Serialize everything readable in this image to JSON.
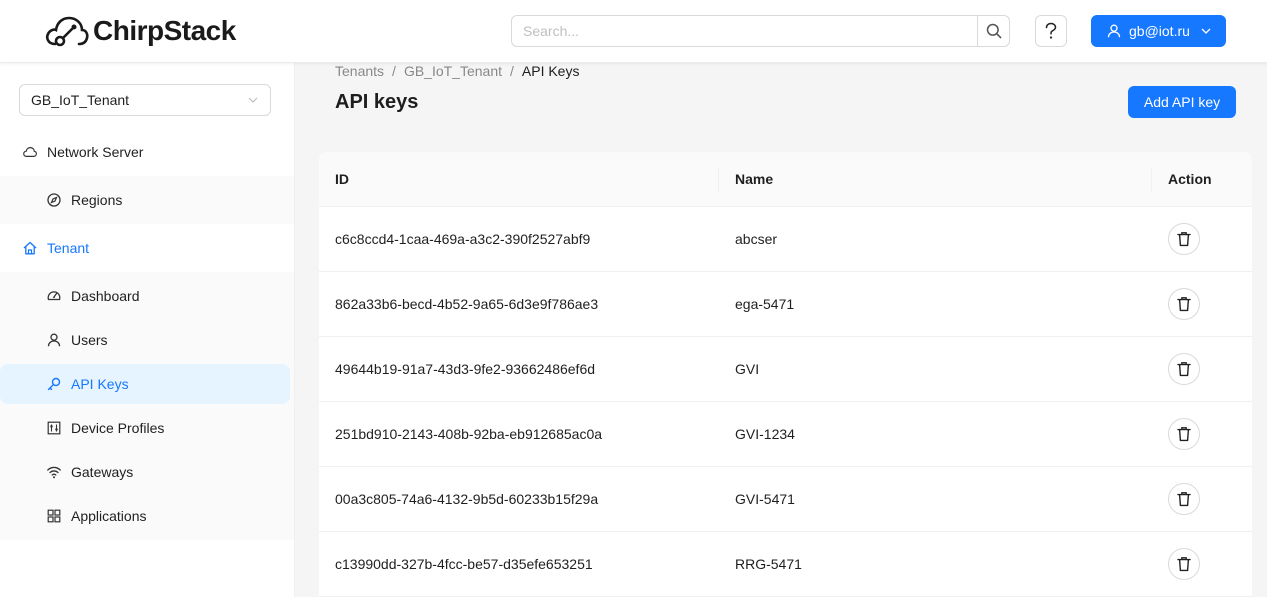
{
  "header": {
    "logo_text": "ChirpStack",
    "search_placeholder": "Search...",
    "user_email": "gb@iot.ru"
  },
  "sidebar": {
    "tenant_select": "GB_IoT_Tenant",
    "network_server": {
      "label": "Network Server",
      "icon": "cloud-icon"
    },
    "regions": {
      "label": "Regions",
      "icon": "compass-icon"
    },
    "tenant": {
      "label": "Tenant",
      "icon": "home-icon"
    },
    "items": [
      {
        "label": "Dashboard",
        "icon": "dashboard-icon"
      },
      {
        "label": "Users",
        "icon": "user-icon"
      },
      {
        "label": "API Keys",
        "icon": "key-icon",
        "selected": true
      },
      {
        "label": "Device Profiles",
        "icon": "control-icon"
      },
      {
        "label": "Gateways",
        "icon": "wifi-icon"
      },
      {
        "label": "Applications",
        "icon": "appstore-icon"
      }
    ]
  },
  "breadcrumb": [
    "Tenants",
    "GB_IoT_Tenant",
    "API Keys"
  ],
  "page": {
    "title": "API keys",
    "add_button": "Add API key"
  },
  "table": {
    "columns": [
      "ID",
      "Name",
      "Action"
    ],
    "rows": [
      {
        "id": "c6c8ccd4-1caa-469a-a3c2-390f2527abf9",
        "name": "abcser"
      },
      {
        "id": "862a33b6-becd-4b52-9a65-6d3e9f786ae3",
        "name": "ega-5471"
      },
      {
        "id": "49644b19-91a7-43d3-9fe2-93662486ef6d",
        "name": "GVI"
      },
      {
        "id": "251bd910-2143-408b-92ba-eb912685ac0a",
        "name": "GVI-1234"
      },
      {
        "id": "00a3c805-74a6-4132-9b5d-60233b15f29a",
        "name": "GVI-5471"
      },
      {
        "id": "c13990dd-327b-4fcc-be57-d35efe653251",
        "name": "RRG-5471"
      }
    ]
  },
  "colors": {
    "primary": "#1677ff",
    "selected_bg": "#e6f4ff"
  }
}
